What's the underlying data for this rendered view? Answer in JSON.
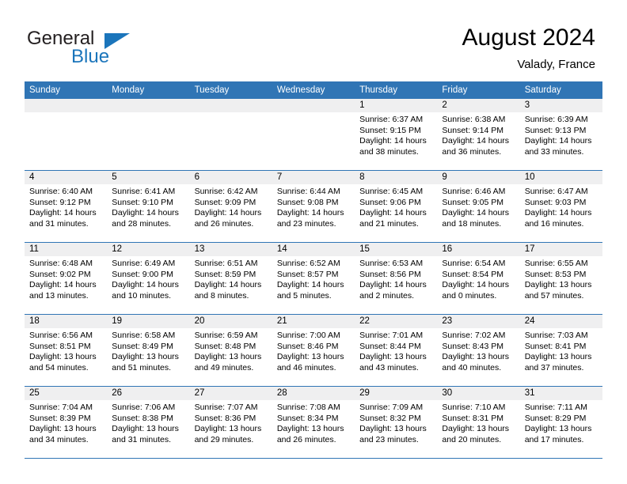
{
  "brand": {
    "name_top": "General",
    "name_bottom": "Blue",
    "accent_color": "#1b75bb"
  },
  "header": {
    "month_title": "August 2024",
    "location": "Valady, France"
  },
  "theme": {
    "header_row_color": "#3075b5",
    "day_band_color": "#efeff0",
    "text_color": "#000000"
  },
  "weekdays": [
    "Sunday",
    "Monday",
    "Tuesday",
    "Wednesday",
    "Thursday",
    "Friday",
    "Saturday"
  ],
  "weeks": [
    [
      {
        "day": "",
        "empty": true
      },
      {
        "day": "",
        "empty": true
      },
      {
        "day": "",
        "empty": true
      },
      {
        "day": "",
        "empty": true
      },
      {
        "day": "1",
        "sunrise": "Sunrise: 6:37 AM",
        "sunset": "Sunset: 9:15 PM",
        "daylight": "Daylight: 14 hours and 38 minutes."
      },
      {
        "day": "2",
        "sunrise": "Sunrise: 6:38 AM",
        "sunset": "Sunset: 9:14 PM",
        "daylight": "Daylight: 14 hours and 36 minutes."
      },
      {
        "day": "3",
        "sunrise": "Sunrise: 6:39 AM",
        "sunset": "Sunset: 9:13 PM",
        "daylight": "Daylight: 14 hours and 33 minutes."
      }
    ],
    [
      {
        "day": "4",
        "sunrise": "Sunrise: 6:40 AM",
        "sunset": "Sunset: 9:12 PM",
        "daylight": "Daylight: 14 hours and 31 minutes."
      },
      {
        "day": "5",
        "sunrise": "Sunrise: 6:41 AM",
        "sunset": "Sunset: 9:10 PM",
        "daylight": "Daylight: 14 hours and 28 minutes."
      },
      {
        "day": "6",
        "sunrise": "Sunrise: 6:42 AM",
        "sunset": "Sunset: 9:09 PM",
        "daylight": "Daylight: 14 hours and 26 minutes."
      },
      {
        "day": "7",
        "sunrise": "Sunrise: 6:44 AM",
        "sunset": "Sunset: 9:08 PM",
        "daylight": "Daylight: 14 hours and 23 minutes."
      },
      {
        "day": "8",
        "sunrise": "Sunrise: 6:45 AM",
        "sunset": "Sunset: 9:06 PM",
        "daylight": "Daylight: 14 hours and 21 minutes."
      },
      {
        "day": "9",
        "sunrise": "Sunrise: 6:46 AM",
        "sunset": "Sunset: 9:05 PM",
        "daylight": "Daylight: 14 hours and 18 minutes."
      },
      {
        "day": "10",
        "sunrise": "Sunrise: 6:47 AM",
        "sunset": "Sunset: 9:03 PM",
        "daylight": "Daylight: 14 hours and 16 minutes."
      }
    ],
    [
      {
        "day": "11",
        "sunrise": "Sunrise: 6:48 AM",
        "sunset": "Sunset: 9:02 PM",
        "daylight": "Daylight: 14 hours and 13 minutes."
      },
      {
        "day": "12",
        "sunrise": "Sunrise: 6:49 AM",
        "sunset": "Sunset: 9:00 PM",
        "daylight": "Daylight: 14 hours and 10 minutes."
      },
      {
        "day": "13",
        "sunrise": "Sunrise: 6:51 AM",
        "sunset": "Sunset: 8:59 PM",
        "daylight": "Daylight: 14 hours and 8 minutes."
      },
      {
        "day": "14",
        "sunrise": "Sunrise: 6:52 AM",
        "sunset": "Sunset: 8:57 PM",
        "daylight": "Daylight: 14 hours and 5 minutes."
      },
      {
        "day": "15",
        "sunrise": "Sunrise: 6:53 AM",
        "sunset": "Sunset: 8:56 PM",
        "daylight": "Daylight: 14 hours and 2 minutes."
      },
      {
        "day": "16",
        "sunrise": "Sunrise: 6:54 AM",
        "sunset": "Sunset: 8:54 PM",
        "daylight": "Daylight: 14 hours and 0 minutes."
      },
      {
        "day": "17",
        "sunrise": "Sunrise: 6:55 AM",
        "sunset": "Sunset: 8:53 PM",
        "daylight": "Daylight: 13 hours and 57 minutes."
      }
    ],
    [
      {
        "day": "18",
        "sunrise": "Sunrise: 6:56 AM",
        "sunset": "Sunset: 8:51 PM",
        "daylight": "Daylight: 13 hours and 54 minutes."
      },
      {
        "day": "19",
        "sunrise": "Sunrise: 6:58 AM",
        "sunset": "Sunset: 8:49 PM",
        "daylight": "Daylight: 13 hours and 51 minutes."
      },
      {
        "day": "20",
        "sunrise": "Sunrise: 6:59 AM",
        "sunset": "Sunset: 8:48 PM",
        "daylight": "Daylight: 13 hours and 49 minutes."
      },
      {
        "day": "21",
        "sunrise": "Sunrise: 7:00 AM",
        "sunset": "Sunset: 8:46 PM",
        "daylight": "Daylight: 13 hours and 46 minutes."
      },
      {
        "day": "22",
        "sunrise": "Sunrise: 7:01 AM",
        "sunset": "Sunset: 8:44 PM",
        "daylight": "Daylight: 13 hours and 43 minutes."
      },
      {
        "day": "23",
        "sunrise": "Sunrise: 7:02 AM",
        "sunset": "Sunset: 8:43 PM",
        "daylight": "Daylight: 13 hours and 40 minutes."
      },
      {
        "day": "24",
        "sunrise": "Sunrise: 7:03 AM",
        "sunset": "Sunset: 8:41 PM",
        "daylight": "Daylight: 13 hours and 37 minutes."
      }
    ],
    [
      {
        "day": "25",
        "sunrise": "Sunrise: 7:04 AM",
        "sunset": "Sunset: 8:39 PM",
        "daylight": "Daylight: 13 hours and 34 minutes."
      },
      {
        "day": "26",
        "sunrise": "Sunrise: 7:06 AM",
        "sunset": "Sunset: 8:38 PM",
        "daylight": "Daylight: 13 hours and 31 minutes."
      },
      {
        "day": "27",
        "sunrise": "Sunrise: 7:07 AM",
        "sunset": "Sunset: 8:36 PM",
        "daylight": "Daylight: 13 hours and 29 minutes."
      },
      {
        "day": "28",
        "sunrise": "Sunrise: 7:08 AM",
        "sunset": "Sunset: 8:34 PM",
        "daylight": "Daylight: 13 hours and 26 minutes."
      },
      {
        "day": "29",
        "sunrise": "Sunrise: 7:09 AM",
        "sunset": "Sunset: 8:32 PM",
        "daylight": "Daylight: 13 hours and 23 minutes."
      },
      {
        "day": "30",
        "sunrise": "Sunrise: 7:10 AM",
        "sunset": "Sunset: 8:31 PM",
        "daylight": "Daylight: 13 hours and 20 minutes."
      },
      {
        "day": "31",
        "sunrise": "Sunrise: 7:11 AM",
        "sunset": "Sunset: 8:29 PM",
        "daylight": "Daylight: 13 hours and 17 minutes."
      }
    ]
  ]
}
